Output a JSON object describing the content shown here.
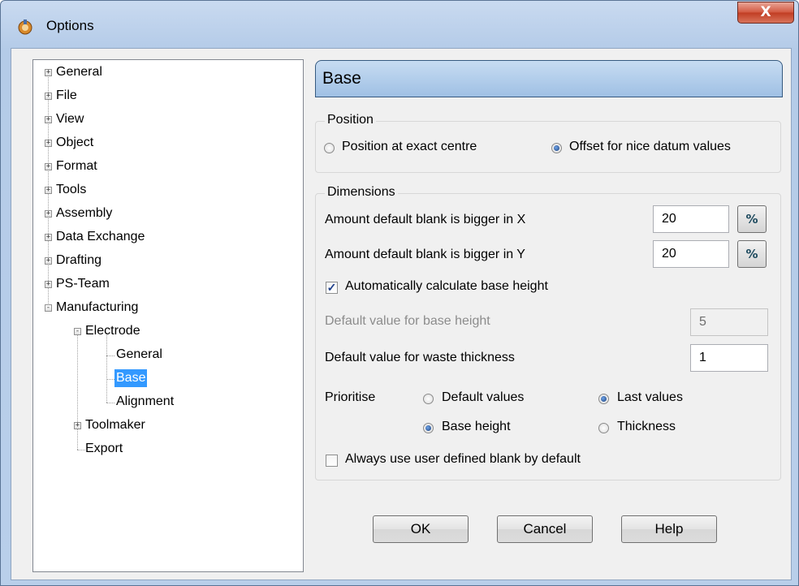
{
  "window": {
    "title": "Options",
    "close_label": "X"
  },
  "tree": {
    "items": [
      {
        "label": "General",
        "expander": "+"
      },
      {
        "label": "File",
        "expander": "+"
      },
      {
        "label": "View",
        "expander": "+"
      },
      {
        "label": "Object",
        "expander": "+"
      },
      {
        "label": "Format",
        "expander": "+"
      },
      {
        "label": "Tools",
        "expander": "+"
      },
      {
        "label": "Assembly",
        "expander": "+"
      },
      {
        "label": "Data Exchange",
        "expander": "+"
      },
      {
        "label": "Drafting",
        "expander": "+"
      },
      {
        "label": "PS-Team",
        "expander": "+"
      },
      {
        "label": "Manufacturing",
        "expander": "-"
      },
      {
        "label": "Electrode",
        "expander": "-"
      },
      {
        "label": "General"
      },
      {
        "label": "Base",
        "selected": true
      },
      {
        "label": "Alignment"
      },
      {
        "label": "Toolmaker",
        "expander": "+"
      },
      {
        "label": "Export"
      }
    ]
  },
  "panel": {
    "title": "Base",
    "position": {
      "group_label": "Position",
      "options": [
        "Position at exact centre",
        "Offset for nice datum values"
      ],
      "selected": "Offset for nice datum values"
    },
    "dimensions": {
      "group_label": "Dimensions",
      "blank_x_label": "Amount default blank is bigger in X",
      "blank_x_value": "20",
      "blank_y_label": "Amount default blank is bigger in Y",
      "blank_y_value": "20",
      "percent_button": "%",
      "auto_base_height_label": "Automatically calculate base height",
      "auto_base_height_checked": true,
      "default_base_height_label": "Default value for base height",
      "default_base_height_value": "5",
      "waste_thickness_label": "Default value for waste thickness",
      "waste_thickness_value": "1",
      "prioritise_label": "Prioritise",
      "prioritise_options": [
        "Default values",
        "Last values",
        "Base height",
        "Thickness"
      ],
      "prioritise_selected": [
        "Last values",
        "Base height"
      ],
      "user_blank_label": "Always use user defined blank by default",
      "user_blank_checked": false
    }
  },
  "buttons": {
    "ok": "OK",
    "cancel": "Cancel",
    "help": "Help"
  },
  "colors": {
    "selection": "#3399ff",
    "header_gradient_top": "#c7dcf2",
    "header_gradient_bottom": "#9fc0e4",
    "close_button": "#c13d23"
  }
}
